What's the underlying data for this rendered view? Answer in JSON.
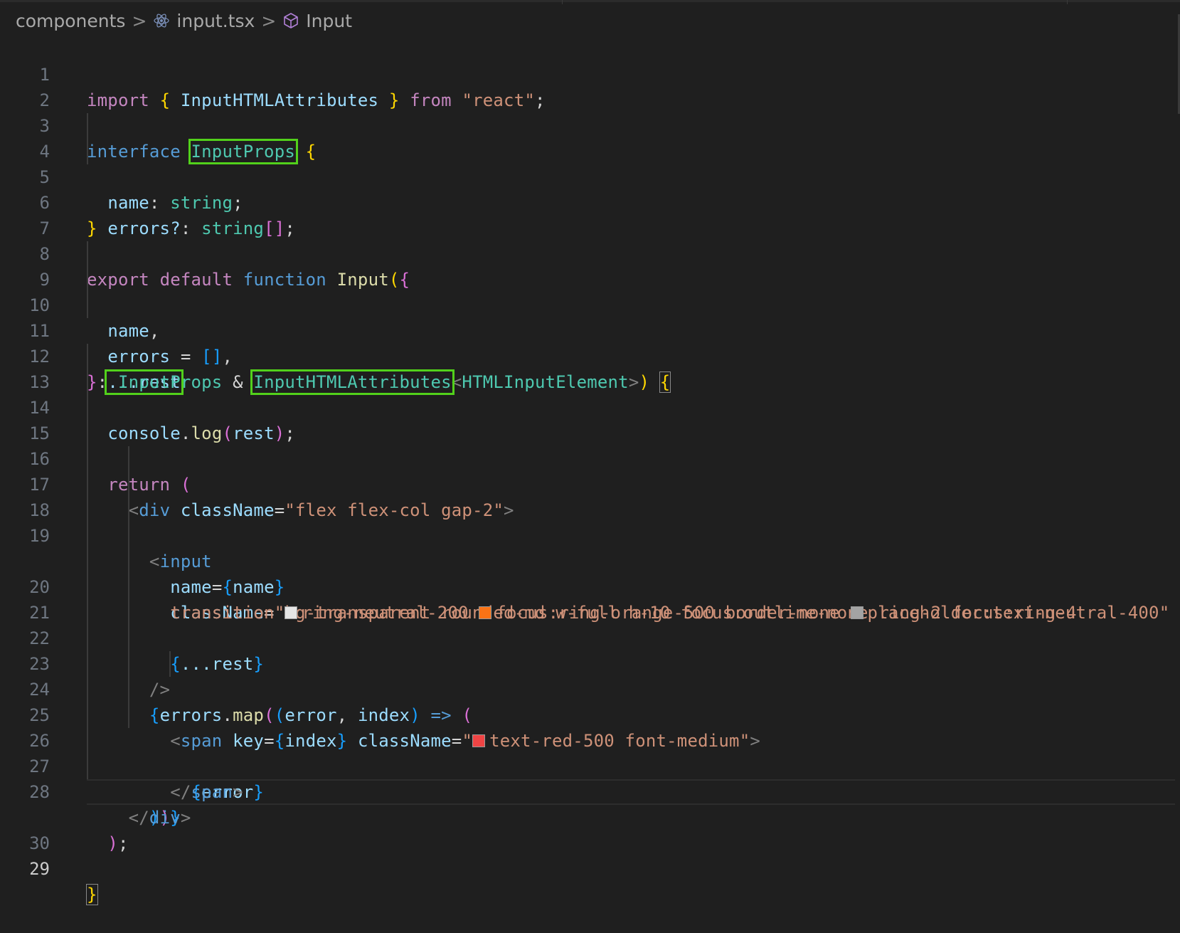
{
  "breadcrumb": {
    "items": [
      "components",
      "input.tsx",
      "Input"
    ],
    "separator": ">"
  },
  "editor": {
    "active_line": "29",
    "line_numbers": [
      "1",
      "2",
      "3",
      "4",
      "5",
      "6",
      "7",
      "8",
      "9",
      "10",
      "11",
      "12",
      "13",
      "14",
      "15",
      "16",
      "17",
      "18",
      "19",
      "20",
      "21",
      "22",
      "23",
      "24",
      "25",
      "26",
      "27",
      "28",
      "29",
      "30"
    ],
    "tokens": {
      "l1": [
        "import",
        "{",
        "InputHTMLAttributes",
        "}",
        "from",
        "\"react\"",
        ";"
      ],
      "l3": [
        "interface",
        "InputProps",
        "{"
      ],
      "l4": [
        "name",
        ": ",
        "string",
        ";"
      ],
      "l5": [
        "errors?",
        ": ",
        "string",
        "[]",
        ";"
      ],
      "l6": [
        "}"
      ],
      "l8": [
        "export",
        "default",
        "function",
        "Input",
        "(",
        "{"
      ],
      "l9": [
        "name",
        ","
      ],
      "l10": [
        "errors",
        " = ",
        "[]",
        ","
      ],
      "l11": [
        "...rest"
      ],
      "l12": [
        "}",
        ": ",
        "InputProps",
        " & ",
        "InputHTMLAttributes",
        "<",
        "HTMLInputElement",
        ">",
        ")",
        " ",
        "{"
      ],
      "l13": [
        "console",
        ".",
        "log",
        "(",
        "rest",
        ")",
        ";"
      ],
      "l15": [
        "return",
        "("
      ],
      "l16": [
        "<",
        "div",
        "className",
        "=",
        "\"flex flex-col gap-2\"",
        ">"
      ],
      "l17": [
        "<",
        "input"
      ],
      "l18": [
        "name",
        "=",
        "{",
        "name",
        "}"
      ],
      "l19": [
        "className",
        "=",
        "\"bg-transparent rounded-md w-full h-10 focus:outline-none ring-2 focus:ring-4"
      ],
      "l19b": [
        "transition",
        "ring-neutral-200",
        "focus:ring-orange-500",
        "border-none",
        "placeholder:text-neutral-400\""
      ],
      "l20": [
        "{",
        "...rest",
        "}"
      ],
      "l21": [
        "/>"
      ],
      "l22": [
        "{",
        "errors",
        ".",
        "map",
        "(",
        "(",
        "error",
        ", ",
        "index",
        ")",
        "=>",
        "("
      ],
      "l23": [
        "<",
        "span",
        "key",
        "=",
        "{",
        "index",
        "}",
        "className",
        "=",
        "\"",
        "text-red-500 font-medium\"",
        ">"
      ],
      "l24": [
        "{",
        "error",
        "}"
      ],
      "l25": [
        "</",
        "span",
        ">"
      ],
      "l26": [
        ")",
        ")",
        "}"
      ],
      "l27": [
        "</",
        "div",
        ">"
      ],
      "l28": [
        ")",
        ";"
      ],
      "l29": [
        "}"
      ]
    }
  },
  "colors": {
    "highlight_box": "#52d11b",
    "swatch_neutral_200": "#e5e5e5",
    "swatch_orange_500": "#f97316",
    "swatch_neutral_400": "#a3a3a3",
    "swatch_red_500": "#ef4444"
  },
  "icons": {
    "file": "react-icon",
    "symbol": "cube-icon"
  }
}
